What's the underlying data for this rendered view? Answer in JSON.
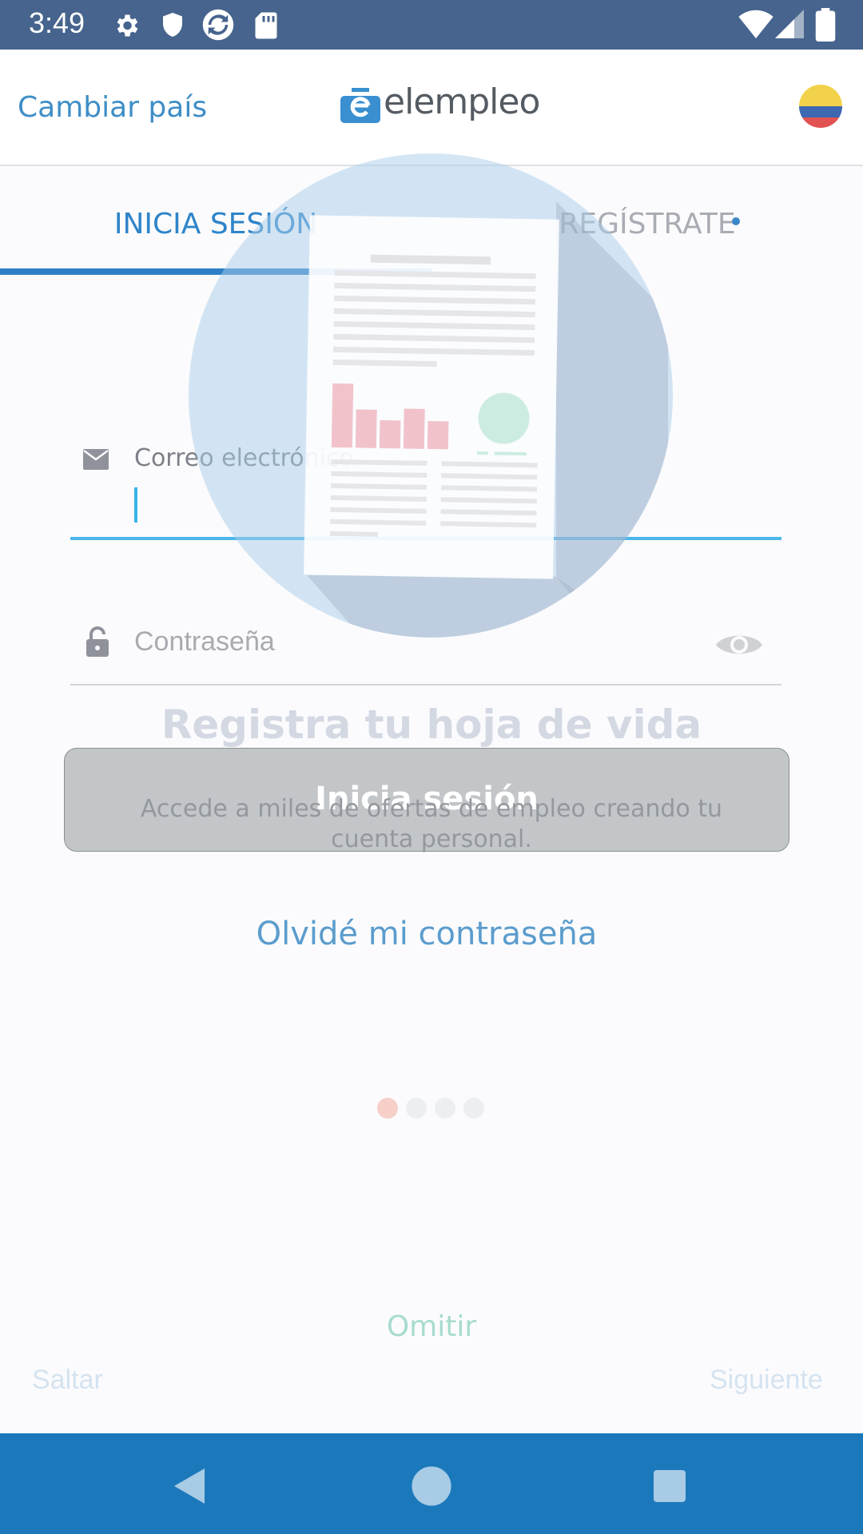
{
  "status_bar": {
    "time": "3:49"
  },
  "header": {
    "change_country": "Cambiar país",
    "logo_text": "elempleo"
  },
  "tabs": [
    {
      "label": "INICIA SESIÓN",
      "selected": true
    },
    {
      "label": "REGÍSTRATE",
      "selected": false
    }
  ],
  "form": {
    "email_label": "Correo electrónico",
    "email_value": "",
    "password_placeholder": "Contraseña",
    "login_button": "Inicia sesión",
    "forgot_password": "Olvidé mi contraseña"
  },
  "onboarding": {
    "title": "Registra tu hoja de vida",
    "description": "Accede a miles de ofertas de empleo creando tu cuenta personal.",
    "pages": 4,
    "current_page": 1,
    "skip": "Omitir",
    "left_action": "Saltar",
    "right_action": "Siguiente"
  },
  "colors": {
    "accent": "#2e84c9",
    "status_bar": "#46648d",
    "nav_bar": "#1b79bb",
    "active_dot": "#f5cfc8"
  },
  "icons": [
    "settings-icon",
    "shield-icon",
    "sync-icon",
    "sd-card-icon",
    "wifi-icon",
    "signal-icon",
    "battery-icon",
    "mail-icon",
    "lock-icon",
    "eye-icon",
    "back-icon",
    "home-icon",
    "recents-icon"
  ]
}
